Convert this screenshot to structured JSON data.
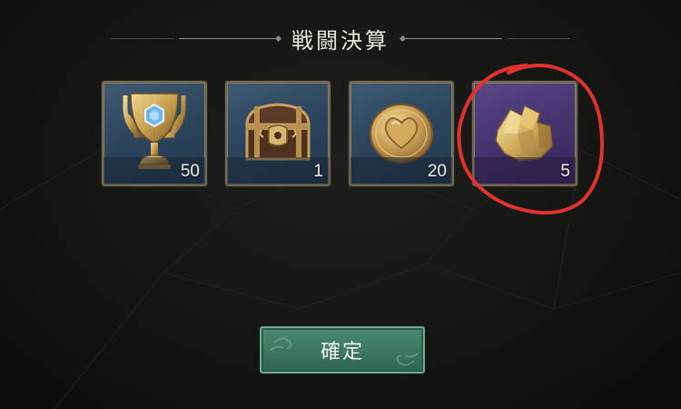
{
  "header": {
    "title": "戦闘決算"
  },
  "rewards": [
    {
      "icon": "trophy-icon",
      "quantity": "50",
      "rarity": "blue"
    },
    {
      "icon": "treasure-chest-icon",
      "quantity": "1",
      "rarity": "blue"
    },
    {
      "icon": "heart-coin-icon",
      "quantity": "20",
      "rarity": "blue"
    },
    {
      "icon": "gold-ore-icon",
      "quantity": "5",
      "rarity": "purple"
    }
  ],
  "confirm": {
    "label": "確定"
  },
  "colors": {
    "blue_frame": "#2d465e",
    "purple_frame": "#45346e",
    "button_green": "#3c765f",
    "annotation_red": "#e0332f"
  }
}
